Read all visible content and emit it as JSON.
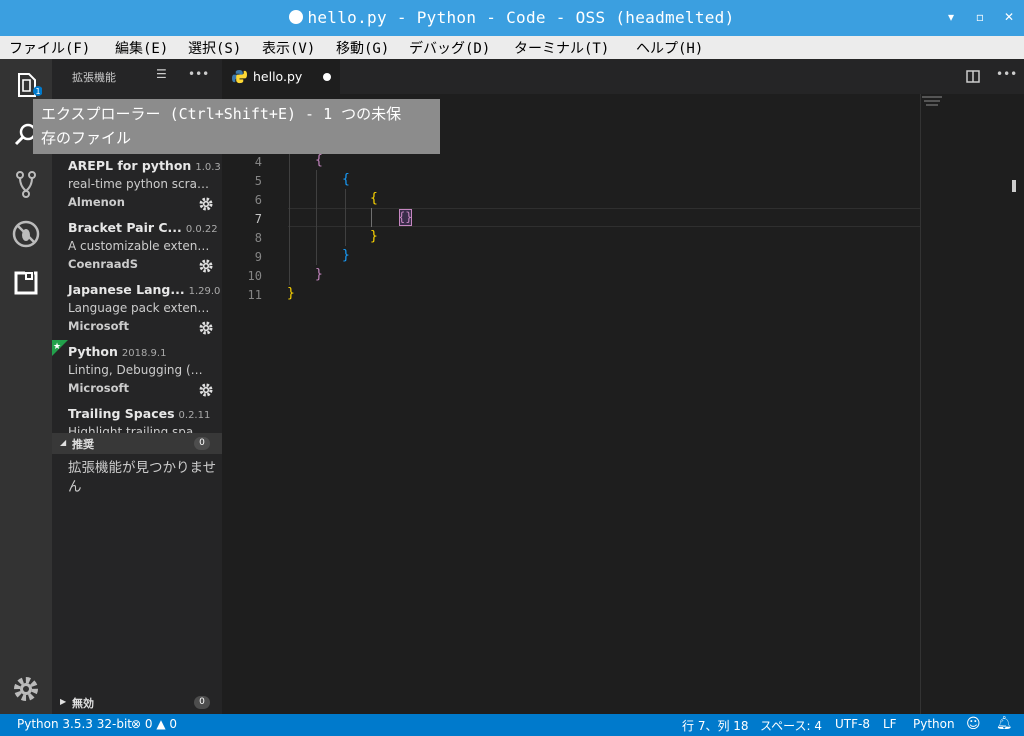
{
  "window": {
    "title": "hello.py - Python - Code - OSS (headmelted)",
    "minimize": "▾",
    "maximize": "▫",
    "close": "✕"
  },
  "menu": [
    "ファイル(F)",
    "編集(E)",
    "選択(S)",
    "表示(V)",
    "移動(G)",
    "デバッグ(D)",
    "ターミナル(T)",
    "ヘルプ(H)"
  ],
  "activity_icons": [
    "explorer-icon",
    "search-icon",
    "source-control-icon",
    "debug-icon",
    "extensions-icon",
    "settings-gear-icon"
  ],
  "sidebar": {
    "title": "拡張機能",
    "extensions": [
      {
        "name": "AREPL for python",
        "version": "1.0.3",
        "description": "real-time python scratchpad",
        "publisher": "Almenon"
      },
      {
        "name": "Bracket Pair C...",
        "version": "0.0.22",
        "description": "A customizable extension",
        "publisher": "CoenraadS"
      },
      {
        "name": "Japanese Lang...",
        "version": "1.29.0",
        "description": "Language pack extension",
        "publisher": "Microsoft"
      },
      {
        "name": "Python",
        "version": "2018.9.1",
        "description": "Linting, Debugging (multi-threaded)",
        "publisher": "Microsoft"
      },
      {
        "name": "Trailing Spaces",
        "version": "0.2.11",
        "description": "Highlight trailing spaces",
        "publisher": ""
      }
    ],
    "recommended": {
      "label": "推奨",
      "count": "0",
      "empty_message": "拡張機能が見つかりません"
    },
    "disabled": {
      "label": "無効",
      "count": "0"
    }
  },
  "tab": {
    "filename": "hello.py"
  },
  "editor": {
    "lines": [
      {
        "num": "4",
        "text": "{",
        "color": "#c586c0"
      },
      {
        "num": "5",
        "text": "{",
        "color": "#179fff"
      },
      {
        "num": "6",
        "text": "{",
        "color": "#ffd700"
      },
      {
        "num": "7",
        "text": "{}",
        "color": "#c586c0"
      },
      {
        "num": "8",
        "text": "}",
        "color": "#ffd700"
      },
      {
        "num": "9",
        "text": "}",
        "color": "#179fff"
      },
      {
        "num": "10",
        "text": "}",
        "color": "#c586c0"
      },
      {
        "num": "11",
        "text": "}",
        "color": "#ffd700"
      }
    ]
  },
  "tooltip": {
    "line1": "エクスプローラー (Ctrl+Shift+E) - 1 つの未保",
    "line2": "存のファイル"
  },
  "status": {
    "interpreter": "Python 3.5.3 32-bit",
    "errors": "0",
    "warnings": "0",
    "position": "行 7、列 18",
    "spaces": "スペース: 4",
    "encoding": "UTF-8",
    "eol": "LF",
    "language": "Python"
  },
  "colors": {
    "accent": "#007acc",
    "titlebar": "#3b9fe0"
  }
}
